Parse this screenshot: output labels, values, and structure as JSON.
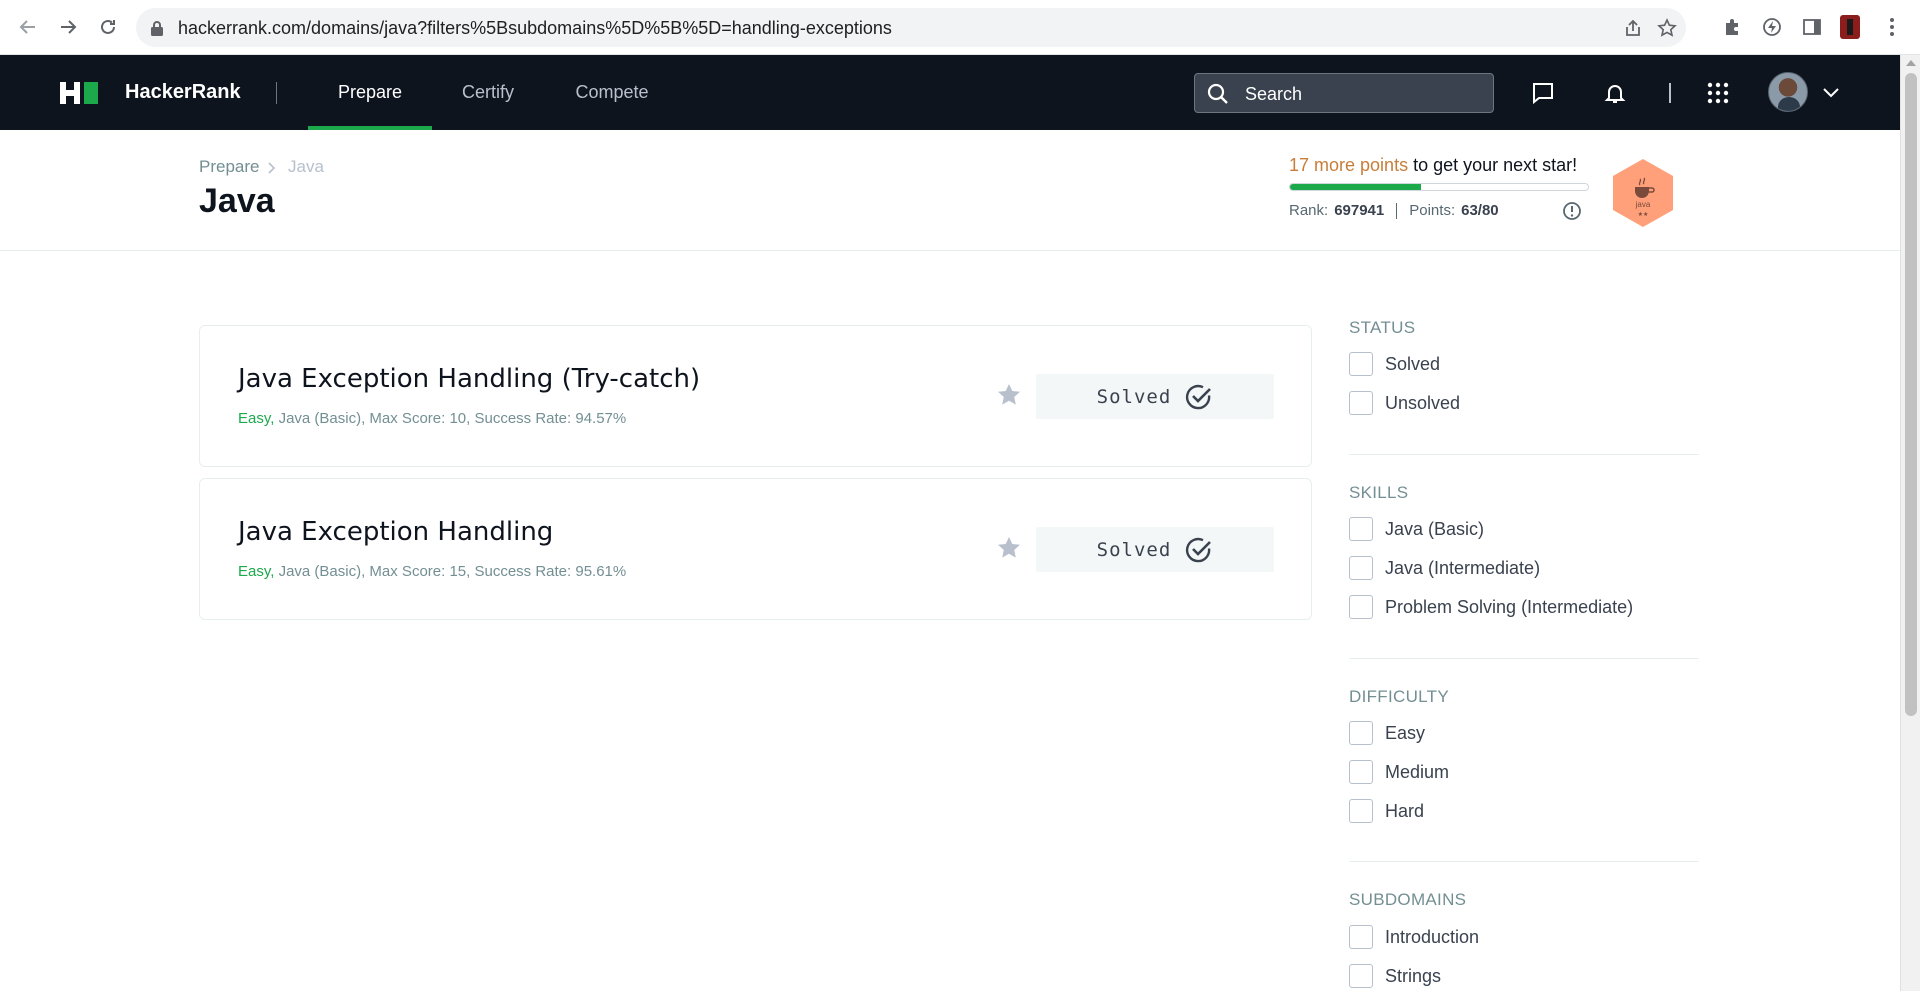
{
  "browser": {
    "url": "hackerrank.com/domains/java?filters%5Bsubdomains%5D%5B%5D=handling-exceptions"
  },
  "nav": {
    "logo": "HackerRank",
    "tabs": [
      {
        "label": "Prepare",
        "active": true
      },
      {
        "label": "Certify",
        "active": false
      },
      {
        "label": "Compete",
        "active": false
      }
    ],
    "search_placeholder": "Search"
  },
  "header": {
    "breadcrumb": [
      "Prepare",
      "Java"
    ],
    "title": "Java",
    "star_points": "17 more points",
    "star_suffix": " to get your next star!",
    "progress_fraction": 0.44,
    "rank_label": "Rank:",
    "rank_value": "697941",
    "points_label": "Points:",
    "points_value": "63/80",
    "badge_text": "java",
    "badge_stars": "★★"
  },
  "challenges": [
    {
      "title": "Java Exception Handling (Try-catch)",
      "difficulty": "Easy,",
      "meta": " Java (Basic), Max Score: 10, Success Rate: 94.57%",
      "status": "Solved"
    },
    {
      "title": "Java Exception Handling",
      "difficulty": "Easy,",
      "meta": " Java (Basic), Max Score: 15, Success Rate: 95.61%",
      "status": "Solved"
    }
  ],
  "filters": {
    "status": {
      "title": "STATUS",
      "options": [
        "Solved",
        "Unsolved"
      ]
    },
    "skills": {
      "title": "SKILLS",
      "options": [
        "Java (Basic)",
        "Java (Intermediate)",
        "Problem Solving (Intermediate)"
      ]
    },
    "difficulty": {
      "title": "DIFFICULTY",
      "options": [
        "Easy",
        "Medium",
        "Hard"
      ]
    },
    "subdomains": {
      "title": "SUBDOMAINS",
      "options": [
        "Introduction",
        "Strings"
      ]
    }
  },
  "colors": {
    "nav_bg": "#0e141e",
    "accent_green": "#1ba94c",
    "points_orange": "#c77e3b",
    "badge_bg": "#ffa07a"
  }
}
